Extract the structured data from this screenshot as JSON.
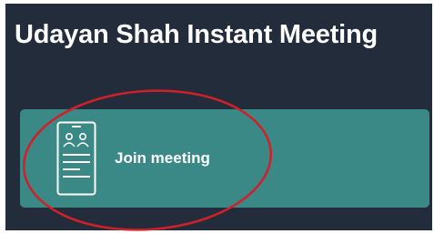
{
  "header": {
    "title": "Udayan Shah Instant Meeting"
  },
  "join_card": {
    "label": "Join meeting",
    "icon": "meeting-device-icon"
  },
  "colors": {
    "background": "#222c3a",
    "card": "#3b8986",
    "text": "#ffffff",
    "annotation_ellipse": "#d0202a"
  }
}
